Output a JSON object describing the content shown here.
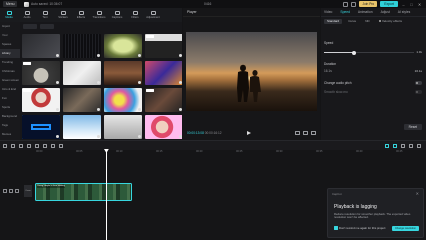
{
  "app": {
    "menu_label": "Menu",
    "title": "Auto saved: 10:36:07",
    "doc_title": "0416",
    "join_pro": "Join Pro",
    "export": "Export"
  },
  "toolbar": {
    "items": [
      "Media",
      "Audio",
      "Text",
      "Stickers",
      "Effects",
      "Transitions",
      "Captions",
      "Filters",
      "Adjustment"
    ]
  },
  "sidebar": {
    "items": [
      "Import",
      "Your",
      "Spaces",
      "Library",
      "Trending",
      "Christmas",
      "Green screen",
      "Intro & End",
      "Fun",
      "Sports",
      "Background",
      "Tags",
      "Memes"
    ]
  },
  "player": {
    "title": "Player",
    "current_time": "00:00:13:08",
    "total_time": "00:00:16:12"
  },
  "props": {
    "tabs": [
      "Video",
      "Speed",
      "Animation",
      "Adjust",
      "AI styles"
    ],
    "subtabs": [
      "Standard",
      "Curve",
      "ND",
      "Velocity effects"
    ],
    "speed_label": "Speed",
    "speed_value": "1.0x",
    "duration_label": "Duration",
    "duration_from": "16.1s",
    "duration_to": "16.1s",
    "pitch_label": "Change audio pitch",
    "smooth_label": "Smooth slow-mo",
    "reset": "Reset"
  },
  "timeline": {
    "ruler": [
      "00:00",
      "00:05",
      "00:10",
      "00:15",
      "00:20",
      "00:25",
      "00:30",
      "00:35",
      "00:40",
      "00:45"
    ],
    "cover_label": "Cover",
    "clip_label": "Young couple in love walking"
  },
  "toast": {
    "header": "CapCut",
    "title": "Playback is lagging",
    "body": "Reduce resolution for smoother playback. The exported video resolution won't be affected.",
    "checkbox_label": "Don't remind me again for this project",
    "button": "Change resolution"
  },
  "colors": {
    "accent": "#37d6df",
    "join_pro": "#e9c46a"
  }
}
